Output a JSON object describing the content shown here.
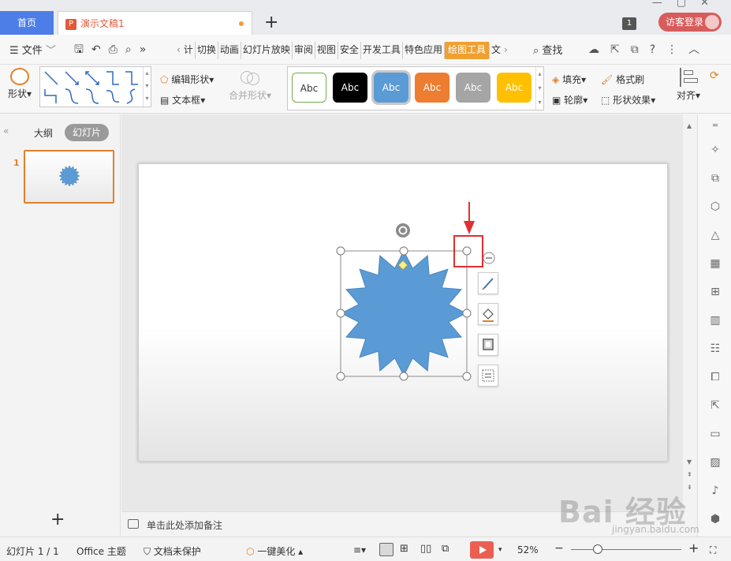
{
  "tabs": {
    "home": "首页",
    "document": "演示文稿1",
    "add": "+"
  },
  "window": {
    "window_badge": "1",
    "login": "访客登录"
  },
  "menu": {
    "file": "文件",
    "tabs": [
      "计",
      "切换",
      "动画",
      "幻灯片放映",
      "审阅",
      "视图",
      "安全",
      "开发工具",
      "特色应用",
      "绘图工具",
      "文"
    ],
    "active_tab": "绘图工具",
    "find": "查找"
  },
  "ribbon": {
    "shape": "形状",
    "edit_shape": "编辑形状",
    "textbox": "文本框",
    "merge_shape": "合并形状",
    "style_label": "Abc",
    "fill": "填充",
    "outline": "轮廓",
    "format_painter": "格式刷",
    "shape_effect": "形状效果",
    "align": "对齐",
    "style_colors": [
      "#ffffff",
      "#000000",
      "#5b9bd5",
      "#ed7d31",
      "#a5a5a5",
      "#ffc000"
    ]
  },
  "left_panel": {
    "outline": "大纲",
    "slides": "幻灯片",
    "slide_number": "1",
    "add": "+"
  },
  "canvas": {
    "shape_color": "#5b9bd5",
    "highlight_color": "#e03030"
  },
  "notes": {
    "placeholder": "单击此处添加备注"
  },
  "status": {
    "slide": "幻灯片 1 / 1",
    "theme": "Office 主题",
    "protect": "文档未保护",
    "beautify": "一键美化",
    "zoom": "52%"
  },
  "watermark": {
    "logo": "Bai 经验",
    "url": "jingyan.baidu.com"
  }
}
